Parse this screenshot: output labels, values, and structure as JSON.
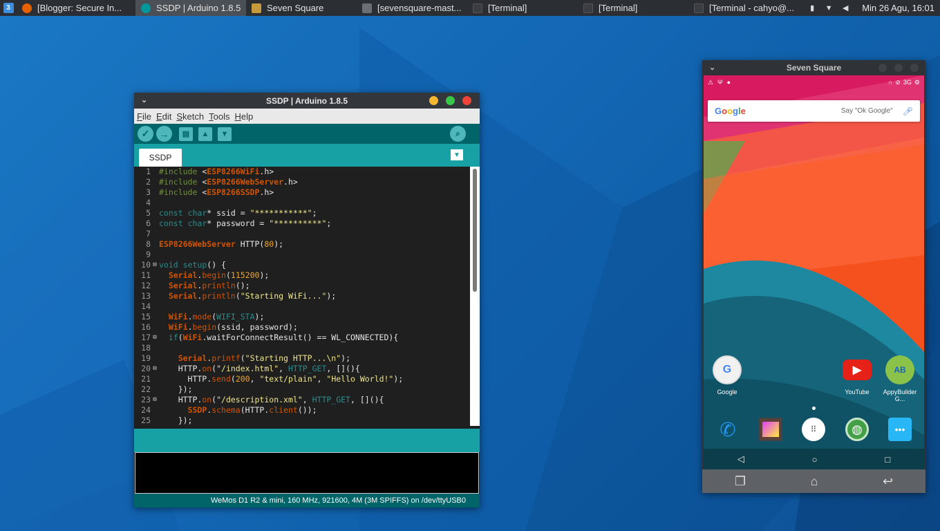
{
  "taskbar": {
    "start_glyph": "3",
    "tasks": [
      {
        "label": "[Blogger: Secure In...",
        "icon": "firefox-icon",
        "color": "#e66000"
      },
      {
        "label": "SSDP | Arduino 1.8.5",
        "icon": "arduino-icon",
        "color": "#00979c"
      },
      {
        "label": "Seven Square",
        "icon": "seven-square-icon",
        "color": "#c49a3a"
      },
      {
        "label": "[sevensquare-mast...",
        "icon": "folder-icon",
        "color": "#6c6f74"
      },
      {
        "label": "[Terminal]",
        "icon": "terminal-icon",
        "color": "#3a3d42"
      },
      {
        "label": "[Terminal]",
        "icon": "terminal-icon",
        "color": "#3a3d42"
      },
      {
        "label": "[Terminal - cahyo@...",
        "icon": "terminal-icon",
        "color": "#3a3d42"
      }
    ],
    "clock": "Min 26 Agu, 16:01"
  },
  "arduino": {
    "title": "SSDP | Arduino 1.8.5",
    "menu": [
      "File",
      "Edit",
      "Sketch",
      "Tools",
      "Help"
    ],
    "tab": "SSDP",
    "status": "WeMos D1 R2 & mini, 160 MHz, 921600, 4M (3M SPIFFS) on /dev/ttyUSB0",
    "code": [
      {
        "n": "1",
        "fold": "",
        "html": "<span class='c-pre'>#include</span> &lt;<span class='c-lib'>ESP8266WiFi</span>.h&gt;"
      },
      {
        "n": "2",
        "fold": "",
        "html": "<span class='c-pre'>#include</span> &lt;<span class='c-lib'>ESP8266WebServer</span>.h&gt;"
      },
      {
        "n": "3",
        "fold": "",
        "html": "<span class='c-pre'>#include</span> &lt;<span class='c-lib'>ESP8266SSDP</span>.h&gt;"
      },
      {
        "n": "4",
        "fold": "",
        "html": ""
      },
      {
        "n": "5",
        "fold": "",
        "html": "<span class='c-kw'>const</span> <span class='c-ty'>char</span>* ssid = <span class='c-str'>\"***********\"</span>;"
      },
      {
        "n": "6",
        "fold": "",
        "html": "<span class='c-kw'>const</span> <span class='c-ty'>char</span>* password = <span class='c-str'>\"**********\"</span>;"
      },
      {
        "n": "7",
        "fold": "",
        "html": ""
      },
      {
        "n": "8",
        "fold": "",
        "html": "<span class='c-lib'>ESP8266WebServer</span> HTTP(<span class='c-num'>80</span>);"
      },
      {
        "n": "9",
        "fold": "",
        "html": ""
      },
      {
        "n": "10",
        "fold": "−",
        "html": "<span class='c-kw'>void</span> <span class='c-kw'>setup</span>() {"
      },
      {
        "n": "11",
        "fold": "",
        "html": "  <span class='c-obj'>Serial</span>.<span class='c-fn'>begin</span>(<span class='c-num'>115200</span>);"
      },
      {
        "n": "12",
        "fold": "",
        "html": "  <span class='c-obj'>Serial</span>.<span class='c-fn'>println</span>();"
      },
      {
        "n": "13",
        "fold": "",
        "html": "  <span class='c-obj'>Serial</span>.<span class='c-fn'>println</span>(<span class='c-str'>\"Starting WiFi...\"</span>);"
      },
      {
        "n": "14",
        "fold": "",
        "html": ""
      },
      {
        "n": "15",
        "fold": "",
        "html": "  <span class='c-obj'>WiFi</span>.<span class='c-fn'>mode</span>(<span class='c-const'>WIFI_STA</span>);"
      },
      {
        "n": "16",
        "fold": "",
        "html": "  <span class='c-obj'>WiFi</span>.<span class='c-fn'>begin</span>(ssid, password);"
      },
      {
        "n": "17",
        "fold": "−",
        "html": "  <span class='c-kw'>if</span>(<span class='c-obj'>WiFi</span>.waitForConnectResult() == WL_CONNECTED){"
      },
      {
        "n": "18",
        "fold": "",
        "html": ""
      },
      {
        "n": "19",
        "fold": "",
        "html": "    <span class='c-obj'>Serial</span>.<span class='c-fn'>printf</span>(<span class='c-str'>\"Starting HTTP...\\n\"</span>);"
      },
      {
        "n": "20",
        "fold": "−",
        "html": "    HTTP.<span class='c-fn'>on</span>(<span class='c-str'>\"/index.html\"</span>, <span class='c-const'>HTTP_GET</span>, [](){"
      },
      {
        "n": "21",
        "fold": "",
        "html": "      HTTP.<span class='c-fn'>send</span>(<span class='c-num'>200</span>, <span class='c-str'>\"text/plain\"</span>, <span class='c-str'>\"Hello World!\"</span>);"
      },
      {
        "n": "22",
        "fold": "",
        "html": "    });"
      },
      {
        "n": "23",
        "fold": "−",
        "html": "    HTTP.<span class='c-fn'>on</span>(<span class='c-str'>\"/description.xml\"</span>, <span class='c-const'>HTTP_GET</span>, [](){"
      },
      {
        "n": "24",
        "fold": "",
        "html": "      <span class='c-obj'>SSDP</span>.<span class='c-fn'>schema</span>(HTTP.<span class='c-fn'>client</span>());"
      },
      {
        "n": "25",
        "fold": "",
        "html": "    });"
      }
    ]
  },
  "seven": {
    "title": "Seven Square",
    "network": "3G",
    "search_logo": "Google",
    "search_hint": "Say \"Ok Google\"",
    "apps": [
      {
        "label": "Google",
        "glyph": "G",
        "bg": "#f1f1f1",
        "fg": "#4285f4"
      },
      {
        "label": "YouTube",
        "glyph": "▶",
        "bg": "#e62117",
        "fg": "#ffffff"
      },
      {
        "label": "AppyBuilder G...",
        "glyph": "AB",
        "bg": "#8bc34a",
        "fg": "#1565c0"
      }
    ],
    "dock": [
      {
        "icon": "phone-icon",
        "glyph": "✆",
        "bg": "#2196f3"
      },
      {
        "icon": "gallery-icon",
        "glyph": "▣",
        "bg": "#7b1fa2"
      },
      {
        "icon": "app-drawer-icon",
        "glyph": "⋮⋮",
        "bg": "#ffffff"
      },
      {
        "icon": "browser-icon",
        "glyph": "◍",
        "bg": "#43a047"
      },
      {
        "icon": "messaging-icon",
        "glyph": "✉",
        "bg": "#29b6f6"
      }
    ]
  }
}
